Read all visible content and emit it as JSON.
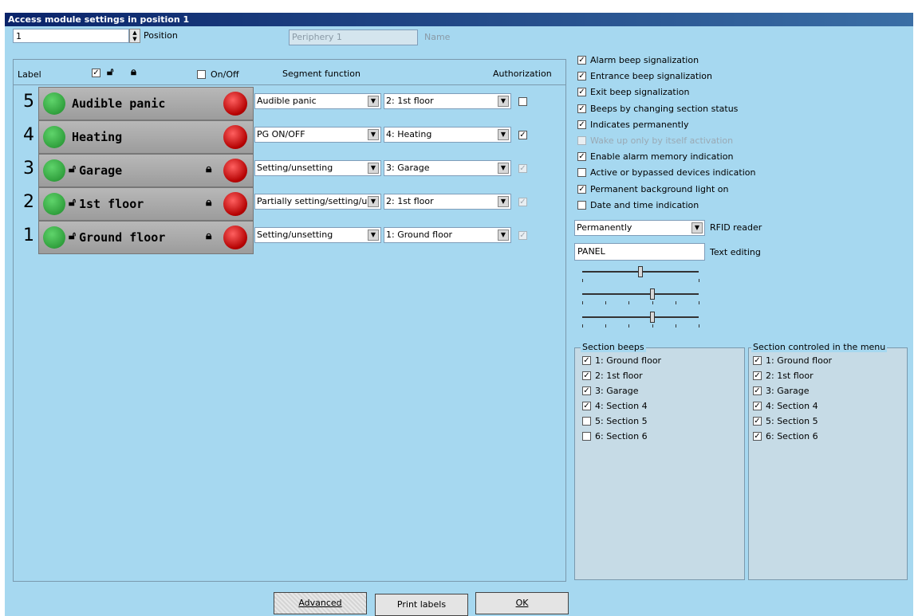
{
  "window": {
    "title": "Access module settings in position 1"
  },
  "top": {
    "position_value": "1",
    "position_label": "Position",
    "name_value": "Periphery 1",
    "name_label": "Name"
  },
  "table": {
    "label_header": "Label",
    "onoff_label": "On/Off",
    "segment_header": "Segment function",
    "auth_header": "Authorization"
  },
  "segments": [
    {
      "num": "5",
      "label": "Audible panic",
      "locked": false,
      "function": "Audible panic",
      "section": "2: 1st floor",
      "auth": true,
      "auth_checked": false,
      "auth_disabled": false
    },
    {
      "num": "4",
      "label": "Heating",
      "locked": false,
      "function": "PG ON/OFF",
      "section": "4: Heating",
      "auth": true,
      "auth_checked": true,
      "auth_disabled": false
    },
    {
      "num": "3",
      "label": "Garage",
      "locked": true,
      "function": "Setting/unsetting",
      "section": "3: Garage",
      "auth": true,
      "auth_checked": true,
      "auth_disabled": true
    },
    {
      "num": "2",
      "label": "1st floor",
      "locked": true,
      "function": "Partially setting/setting/ur",
      "section": "2: 1st floor",
      "auth": true,
      "auth_checked": true,
      "auth_disabled": true
    },
    {
      "num": "1",
      "label": "Ground floor",
      "locked": true,
      "function": "Setting/unsetting",
      "section": "1: Ground floor",
      "auth": true,
      "auth_checked": true,
      "auth_disabled": true
    }
  ],
  "options": [
    {
      "label": "Alarm beep signalization",
      "checked": true,
      "disabled": false
    },
    {
      "label": "Entrance beep signalization",
      "checked": true,
      "disabled": false
    },
    {
      "label": "Exit beep signalization",
      "checked": true,
      "disabled": false
    },
    {
      "label": "Beeps by changing section status",
      "checked": true,
      "disabled": false
    },
    {
      "label": "Indicates permanently",
      "checked": true,
      "disabled": false
    },
    {
      "label": "Wake up only by itself activation",
      "checked": false,
      "disabled": true
    },
    {
      "label": "Enable alarm memory indication",
      "checked": true,
      "disabled": false
    },
    {
      "label": "Active or bypassed devices indication",
      "checked": false,
      "disabled": false
    },
    {
      "label": "Permanent background light on",
      "checked": true,
      "disabled": false
    },
    {
      "label": "Date and time indication",
      "checked": false,
      "disabled": false
    }
  ],
  "rfid": {
    "value": "Permanently",
    "label": "RFID reader"
  },
  "text_editing": {
    "value": "PANEL",
    "label": "Text editing"
  },
  "sliders": [
    {
      "level": 0.5
    },
    {
      "level": 0.6
    },
    {
      "level": 0.6
    }
  ],
  "section_beeps": {
    "title": "Section beeps",
    "items": [
      {
        "label": "1: Ground floor",
        "checked": true
      },
      {
        "label": "2: 1st floor",
        "checked": true
      },
      {
        "label": "3: Garage",
        "checked": true
      },
      {
        "label": "4: Section 4",
        "checked": true
      },
      {
        "label": "5: Section 5",
        "checked": false
      },
      {
        "label": "6: Section 6",
        "checked": false
      }
    ]
  },
  "section_menu": {
    "title": "Section controled in the menu",
    "items": [
      {
        "label": "1: Ground floor",
        "checked": true
      },
      {
        "label": "2: 1st floor",
        "checked": true
      },
      {
        "label": "3: Garage",
        "checked": true
      },
      {
        "label": "4: Section 4",
        "checked": true
      },
      {
        "label": "5: Section 5",
        "checked": true
      },
      {
        "label": "6: Section 6",
        "checked": true
      }
    ]
  },
  "buttons": {
    "advanced": "Advanced",
    "print": "Print labels",
    "ok": "OK"
  }
}
